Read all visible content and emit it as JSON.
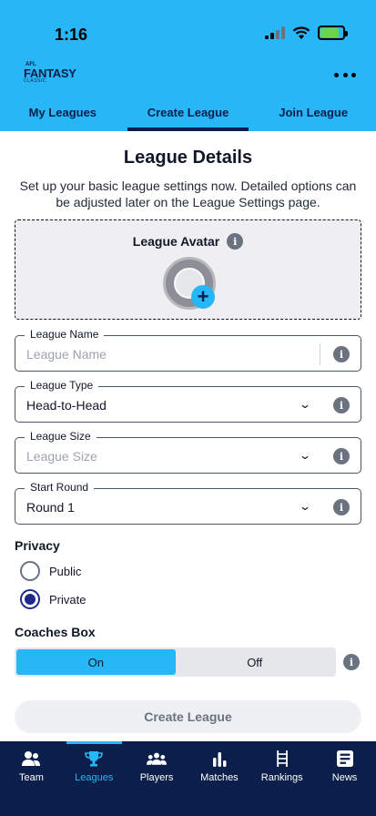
{
  "status": {
    "time": "1:16"
  },
  "app": {
    "logo_afl": "AFL",
    "logo_fantasy": "FANTASY",
    "logo_classic": "CLASSIC"
  },
  "tabs": [
    {
      "label": "My Leagues",
      "active": false
    },
    {
      "label": "Create League",
      "active": true
    },
    {
      "label": "Join League",
      "active": false
    }
  ],
  "page": {
    "title": "League Details",
    "subtitle": "Set up your basic league settings now. Detailed options can be adjusted later on the League Settings page."
  },
  "avatar": {
    "title": "League Avatar"
  },
  "fields": {
    "league_name": {
      "label": "League Name",
      "placeholder": "League Name"
    },
    "league_type": {
      "label": "League Type",
      "value": "Head-to-Head"
    },
    "league_size": {
      "label": "League Size",
      "placeholder": "League Size"
    },
    "start_round": {
      "label": "Start Round",
      "value": "Round 1"
    }
  },
  "privacy": {
    "label": "Privacy",
    "options": [
      {
        "label": "Public",
        "checked": false
      },
      {
        "label": "Private",
        "checked": true
      }
    ]
  },
  "coaches_box": {
    "label": "Coaches Box",
    "on_label": "On",
    "off_label": "Off",
    "selected": "On"
  },
  "create_button": {
    "label": "Create League"
  },
  "nav": [
    {
      "label": "Team",
      "icon": "team-icon"
    },
    {
      "label": "Leagues",
      "icon": "trophy-icon"
    },
    {
      "label": "Players",
      "icon": "players-icon"
    },
    {
      "label": "Matches",
      "icon": "bar-chart-icon"
    },
    {
      "label": "Rankings",
      "icon": "ladder-icon"
    },
    {
      "label": "News",
      "icon": "news-icon"
    }
  ],
  "colors": {
    "brand": "#27b6f6",
    "navy": "#0b1f4a",
    "radio": "#1e2a8a"
  }
}
